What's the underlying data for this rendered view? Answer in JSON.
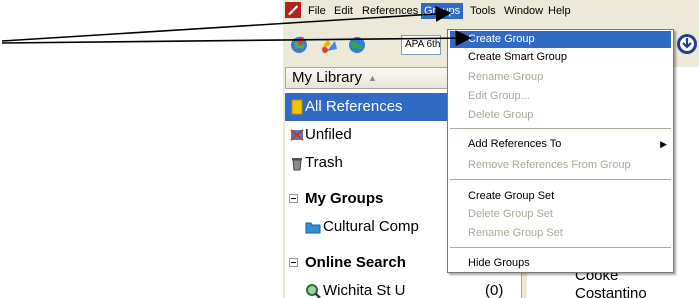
{
  "menubar": {
    "items": [
      "File",
      "Edit",
      "References",
      "Groups",
      "Tools",
      "Window",
      "Help"
    ],
    "active": "Groups"
  },
  "toolbar": {
    "style_value": "APA 6th",
    "icons": [
      "globe-search-icon",
      "connect-icon",
      "online-globe-icon",
      "help-icon"
    ]
  },
  "sidebar": {
    "header": "My Library",
    "all_references": "All References",
    "unfiled": "Unfiled",
    "trash": "Trash",
    "my_groups": "My Groups",
    "group_item": "Cultural Comp",
    "online_search": "Online Search",
    "search_item": "Wichita St U",
    "search_count": "(0)"
  },
  "refpane": {
    "visible_text": [
      "Cooke",
      "Costantino"
    ]
  },
  "dropdown": {
    "items": [
      {
        "label": "Create Group",
        "state": "highlighted"
      },
      {
        "label": "Create Smart Group",
        "state": "enabled"
      },
      {
        "label": "Rename Group",
        "state": "disabled"
      },
      {
        "label": "Edit Group...",
        "state": "disabled"
      },
      {
        "label": "Delete Group",
        "state": "disabled"
      },
      {
        "label": "Add References To",
        "state": "enabled",
        "submenu": true
      },
      {
        "label": "Remove References From Group",
        "state": "disabled"
      },
      {
        "label": "Create Group Set",
        "state": "enabled"
      },
      {
        "label": "Delete Group Set",
        "state": "disabled"
      },
      {
        "label": "Rename Group Set",
        "state": "disabled"
      },
      {
        "label": "Hide Groups",
        "state": "enabled"
      }
    ]
  },
  "colors": {
    "selection": "#316ac5",
    "window_bg": "#ece9d8",
    "disabled_text": "#aca899"
  }
}
